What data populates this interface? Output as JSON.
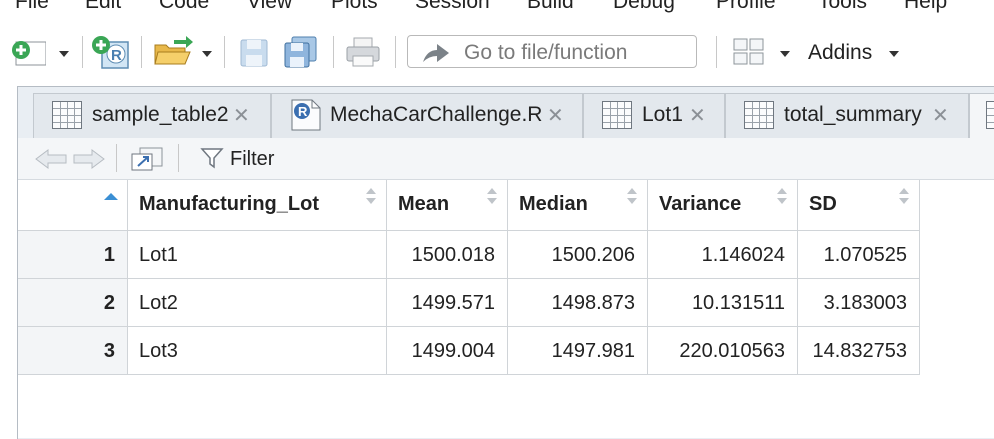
{
  "menu": [
    "File",
    "Edit",
    "Code",
    "View",
    "Plots",
    "Session",
    "Build",
    "Debug",
    "Profile",
    "Tools",
    "Help"
  ],
  "toolbar": {
    "goto_placeholder": "Go to file/function",
    "addins_label": "Addins"
  },
  "tabs": [
    {
      "label": "sample_table2",
      "icon": "table-icon"
    },
    {
      "label": "MechaCarChallenge.R",
      "icon": "r-script-icon"
    },
    {
      "label": "Lot1",
      "icon": "table-icon"
    },
    {
      "label": "total_summary",
      "icon": "table-icon"
    }
  ],
  "tab_close_glyph": "✕",
  "viewer": {
    "filter_label": "Filter"
  },
  "table": {
    "columns": [
      "Manufacturing_Lot",
      "Mean",
      "Median",
      "Variance",
      "SD"
    ],
    "rows": [
      {
        "num": "1",
        "cells": [
          "Lot1",
          "1500.018",
          "1500.206",
          "1.146024",
          "1.070525"
        ]
      },
      {
        "num": "2",
        "cells": [
          "Lot2",
          "1499.571",
          "1498.873",
          "10.131511",
          "3.183003"
        ]
      },
      {
        "num": "3",
        "cells": [
          "Lot3",
          "1499.004",
          "1497.981",
          "220.010563",
          "14.832753"
        ]
      }
    ]
  },
  "colors": {
    "accent_blue": "#3b8fd4",
    "green_add": "#3aa655",
    "pane_bg": "#e9eef3"
  }
}
